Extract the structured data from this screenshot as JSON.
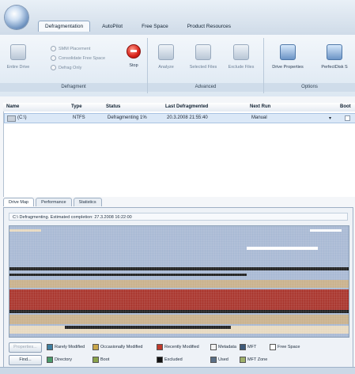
{
  "tabs": [
    "Defragmentation",
    "AutoPilot",
    "Free Space",
    "Product Resources"
  ],
  "ribbon": {
    "defragment": {
      "label": "Defragment",
      "entire_drive": "Entire Drive",
      "options": [
        "SMM Placement",
        "Consolidate Free Space",
        "Defrag Only"
      ],
      "stop": "Stop"
    },
    "advanced": {
      "label": "Advanced",
      "buttons": [
        "Analyze",
        "Selected Files",
        "Exclude Files"
      ]
    },
    "options": {
      "label": "Options",
      "buttons": [
        "Drive Properties",
        "PerfectDisk S"
      ]
    }
  },
  "drive_list": {
    "columns": [
      "Name",
      "Type",
      "Status",
      "Last Defragmented",
      "Next Run",
      "Boot"
    ],
    "rows": [
      {
        "name": "(C:\\)",
        "type": "NTFS",
        "status": "Defragmenting 1%",
        "last": "20.3.2008 21:55:40",
        "next": "Manual"
      }
    ]
  },
  "drive_map": {
    "tabs": [
      "Drive Map",
      "Performance",
      "Statistics"
    ],
    "status": "C:\\ Defragmenting. Estimated completion: 27.3.2008 16:22:00"
  },
  "legend": {
    "buttons": [
      "Properties...",
      "Find..."
    ],
    "items": [
      {
        "label": "Rarely Modified",
        "color": "#3f7fa0"
      },
      {
        "label": "Occasionally Modified",
        "color": "#c9a64a"
      },
      {
        "label": "Recently Modified",
        "color": "#c0392b"
      },
      {
        "label": "Metadata",
        "color": "#f2f2f2"
      },
      {
        "label": "MFT",
        "color": "#3e5a7a"
      },
      {
        "label": "Free Space",
        "color": "#ffffff"
      },
      {
        "label": "Directory",
        "color": "#4b9a6a"
      },
      {
        "label": "Boot",
        "color": "#8aa34a"
      },
      {
        "label": "Excluded",
        "color": "#111111"
      },
      {
        "label": "Used",
        "color": "#5a6f86"
      },
      {
        "label": "MFT Zone",
        "color": "#9fb06a"
      }
    ]
  },
  "colors": {
    "free_grid": "#a7b8d3",
    "recent": "#a8322a",
    "occasional": "#c8b08a",
    "pale": "#e7d9bf",
    "excluded": "#1c1c1c"
  }
}
